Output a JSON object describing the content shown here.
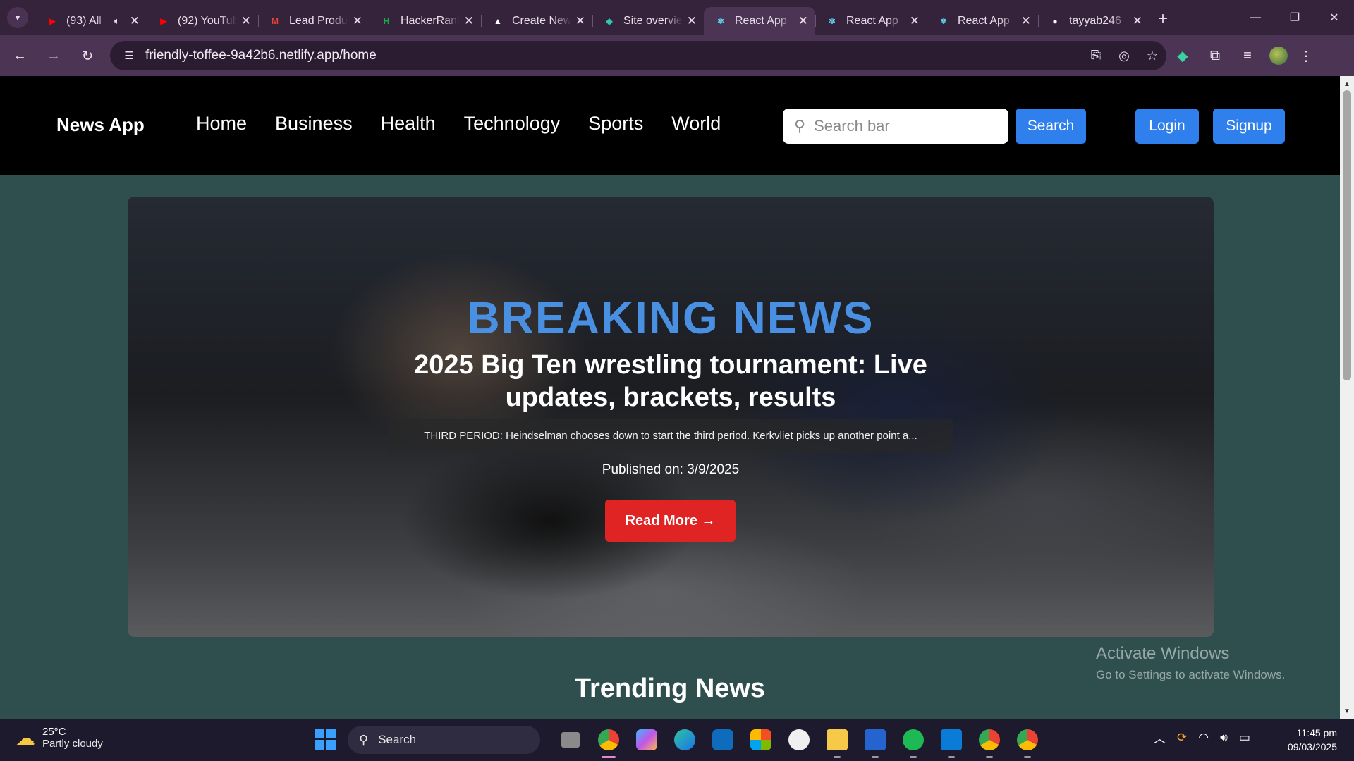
{
  "browser": {
    "tabs": [
      {
        "title": "(93) All",
        "icon": "youtube-icon",
        "icon_color": "#ff0000",
        "muted_icon": true
      },
      {
        "title": "(92) YouTube",
        "icon": "youtube-icon",
        "icon_color": "#ff0000"
      },
      {
        "title": "Lead Product",
        "icon": "gmail-icon",
        "icon_color": "#ea4335"
      },
      {
        "title": "HackerRank",
        "icon": "hackerrank-icon",
        "icon_color": "#1ba94c"
      },
      {
        "title": "Create New",
        "icon": "triangle-icon",
        "icon_color": "#000000"
      },
      {
        "title": "Site overview",
        "icon": "netlify-icon",
        "icon_color": "#32c6b2"
      },
      {
        "title": "React App",
        "icon": "react-icon",
        "icon_color": "#61dafb",
        "active": true
      },
      {
        "title": "React App",
        "icon": "react-icon",
        "icon_color": "#61dafb"
      },
      {
        "title": "React App",
        "icon": "react-icon",
        "icon_color": "#61dafb"
      },
      {
        "title": "tayyab246",
        "icon": "github-icon",
        "icon_color": "#ffffff"
      }
    ],
    "url": "friendly-toffee-9a42b6.netlify.app/home"
  },
  "site": {
    "brand": "News App",
    "nav": [
      "Home",
      "Business",
      "Health",
      "Technology",
      "Sports",
      "World"
    ],
    "search_placeholder": "Search bar",
    "search_button": "Search",
    "login_button": "Login",
    "signup_button": "Signup",
    "accent_color": "#2f80ed"
  },
  "hero": {
    "label": "BREAKING NEWS",
    "headline": "2025 Big Ten wrestling tournament: Live updates, brackets, results",
    "description": "THIRD PERIOD: Heindselman chooses down to start the third period. Kerkvliet picks up another point a...",
    "published": "Published on: 3/9/2025",
    "read_more": "Read More →",
    "label_color": "#4a90e2",
    "button_color": "#e02424"
  },
  "trending_title": "Trending News",
  "watermark": {
    "line1": "Activate Windows",
    "line2": "Go to Settings to activate Windows."
  },
  "taskbar": {
    "weather_temp": "25°C",
    "weather_cond": "Partly cloudy",
    "search": "Search",
    "time": "11:45 pm",
    "date": "09/03/2025"
  }
}
